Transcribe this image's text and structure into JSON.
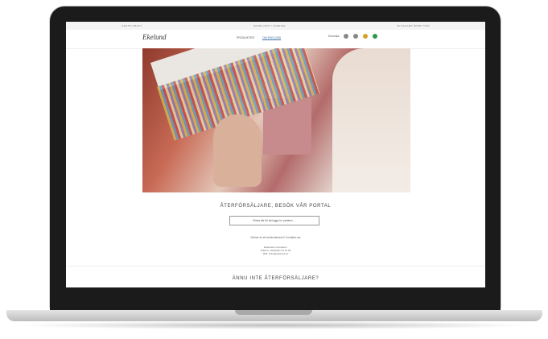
{
  "topbar": {
    "items": [
      "Gratis frakt",
      "Handgjort i Sverige",
      "30 dagars öppet köp"
    ]
  },
  "header": {
    "logo": "Ekelund",
    "nav": [
      "Produkter",
      "Om Ekelund"
    ],
    "language": "Svenska",
    "icons": [
      "search-icon",
      "user-icon",
      "flag-icon",
      "cart-icon"
    ]
  },
  "main": {
    "heading": "ÅTERFÖRSÄLJARE, BESÖK VÅR PORTAL",
    "portal_button": "Klicka här för att logga in i portalen →",
    "note": "Saknar du ett användarnamn? Kontakta oss",
    "contact_lines": [
      "Ekelunds Linneväveri",
      "Telefon: +46(0)321 61 51 00",
      "Mail: order@ekelund.se"
    ],
    "sub_heading": "ÄNNU INTE ÅTERFÖRSÄLJARE?"
  }
}
